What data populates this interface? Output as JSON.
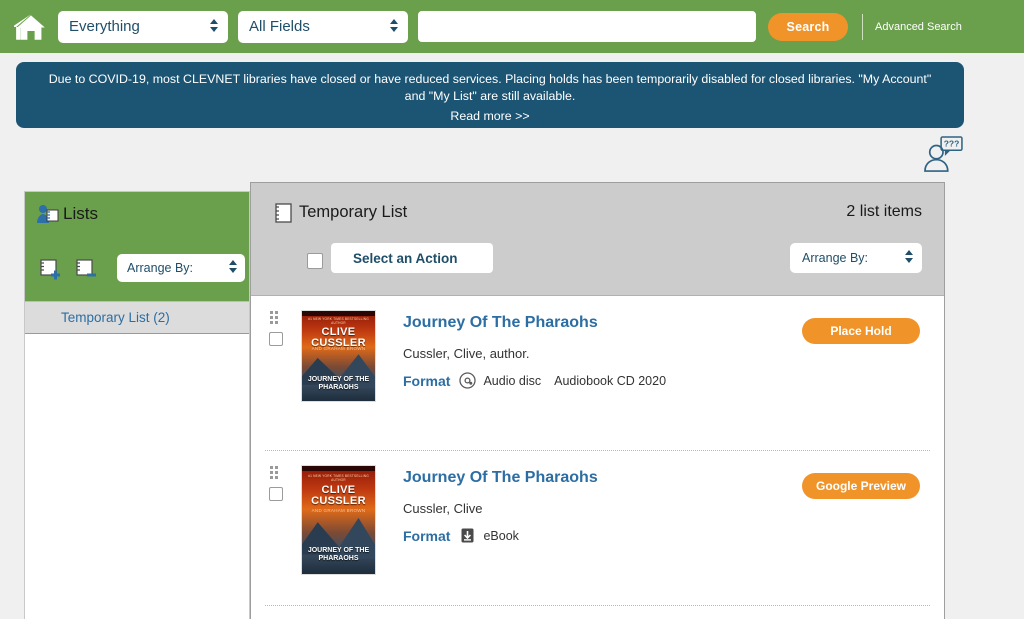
{
  "topbar": {
    "home_icon": "home-icon",
    "scope_select": {
      "value": "Everything"
    },
    "field_select": {
      "value": "All Fields"
    },
    "search_input": {
      "value": "",
      "placeholder": ""
    },
    "search_button": "Search",
    "advanced_search": "Advanced Search"
  },
  "banner": {
    "line1": "Due to COVID-19, most CLEVNET libraries have closed or have reduced services. Placing holds has been temporarily disabled for closed libraries. \"My Account\"",
    "line2": "and \"My List\" are still available.",
    "read_more": "Read more >>"
  },
  "help": {
    "icon": "person-question-icon"
  },
  "sidebar": {
    "title": "Lists",
    "title_icon": "person-list-icon",
    "add_icon": "add-list-icon",
    "remove_icon": "remove-list-icon",
    "arrange_by": {
      "value": "Arrange By:"
    },
    "lists": [
      {
        "label": "Temporary List (2)"
      }
    ]
  },
  "panel": {
    "title": "Temporary List",
    "title_icon": "notebook-icon",
    "item_count": "2 list items",
    "select_an_action": "Select an Action",
    "arrange_by": {
      "value": "Arrange By:"
    }
  },
  "items": [
    {
      "title": "Journey Of The Pharaohs",
      "author": "Cussler, Clive, author.",
      "format_label": "Format",
      "format_icon": "audio-disc-icon",
      "format_text": "Audio disc",
      "format_extra": "Audiobook CD 2020",
      "action_label": "Place Hold",
      "cover": {
        "top_line": "#1 NEW YORK TIMES BESTSELLING AUTHOR",
        "author_line": "CLIVE CUSSLER",
        "sub_line": "AND GRAHAM BROWN",
        "title_line": "JOURNEY OF THE PHARAOHS"
      }
    },
    {
      "title": "Journey Of The Pharaohs",
      "author": "Cussler, Clive",
      "format_label": "Format",
      "format_icon": "ebook-download-icon",
      "format_text": "eBook",
      "format_extra": "",
      "action_label": "Google Preview",
      "cover": {
        "top_line": "#1 NEW YORK TIMES BESTSELLING AUTHOR",
        "author_line": "CLIVE CUSSLER",
        "sub_line": "AND GRAHAM BROWN",
        "title_line": "JOURNEY OF THE PHARAOHS"
      }
    }
  ],
  "colors": {
    "header_green": "#6aa04b",
    "accent_orange": "#f0942a",
    "banner_blue": "#1c5574",
    "link_blue": "#2c6ea3",
    "panel_gray": "#cccccc"
  }
}
